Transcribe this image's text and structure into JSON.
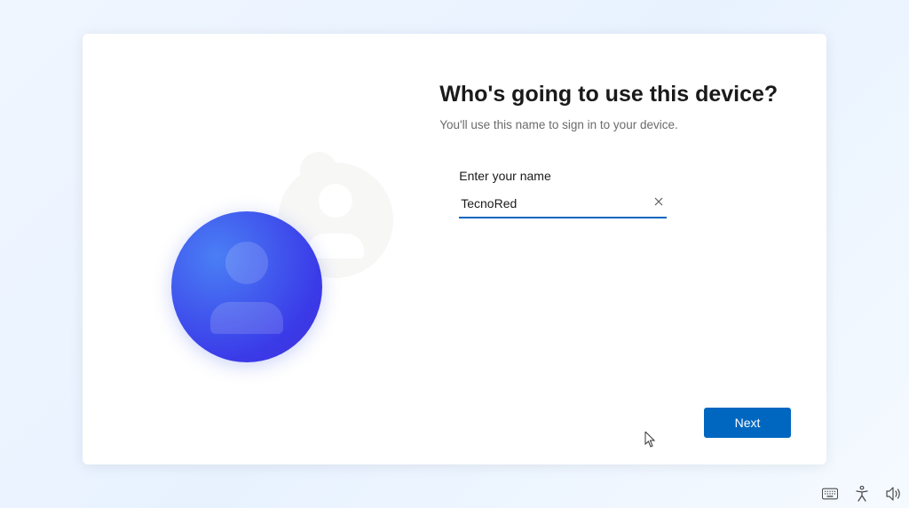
{
  "heading": "Who's going to use this device?",
  "subheading": "You'll use this name to sign in to your device.",
  "input": {
    "label": "Enter your name",
    "value": "TecnoRed"
  },
  "buttons": {
    "next": "Next"
  },
  "colors": {
    "accent": "#0067c0",
    "avatar_gradient_light": "#4a7ff5",
    "avatar_gradient_dark": "#3a3ae8"
  }
}
